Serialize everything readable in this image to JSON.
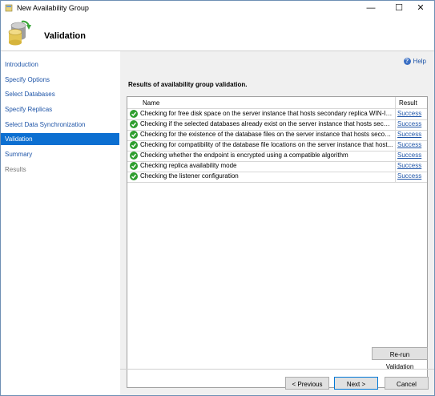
{
  "window": {
    "title": "New Availability Group",
    "controls": {
      "minimize": "—",
      "maximize": "☐",
      "close": "✕"
    }
  },
  "header": {
    "title": "Validation"
  },
  "sidebar": {
    "items": [
      {
        "label": "Introduction",
        "state": "link"
      },
      {
        "label": "Specify Options",
        "state": "link"
      },
      {
        "label": "Select Databases",
        "state": "link"
      },
      {
        "label": "Specify Replicas",
        "state": "link"
      },
      {
        "label": "Select Data Synchronization",
        "state": "link"
      },
      {
        "label": "Validation",
        "state": "active"
      },
      {
        "label": "Summary",
        "state": "link"
      },
      {
        "label": "Results",
        "state": "disabled"
      }
    ]
  },
  "help": {
    "label": "Help"
  },
  "results": {
    "title": "Results of availability group validation.",
    "columns": {
      "name": "Name",
      "result": "Result"
    },
    "rows": [
      {
        "name": "Checking for free disk space on the server instance that hosts secondary replica WIN-IK1...",
        "result": "Success"
      },
      {
        "name": "Checking if the selected databases already exist on the server instance that hosts second...",
        "result": "Success"
      },
      {
        "name": "Checking for the existence of the database files on the server instance that hosts seconda...",
        "result": "Success"
      },
      {
        "name": "Checking for compatibility of the database file locations on the server instance that host...",
        "result": "Success"
      },
      {
        "name": "Checking whether the endpoint is encrypted using a compatible algorithm",
        "result": "Success"
      },
      {
        "name": "Checking replica availability mode",
        "result": "Success"
      },
      {
        "name": "Checking the listener configuration",
        "result": "Success"
      }
    ]
  },
  "buttons": {
    "rerun": "Re-run Validation",
    "previous": "< Previous",
    "next": "Next >",
    "cancel": "Cancel"
  },
  "colors": {
    "accent": "#0c6fd1",
    "link": "#1f55a8",
    "success_icon": "#2f9e2f"
  }
}
